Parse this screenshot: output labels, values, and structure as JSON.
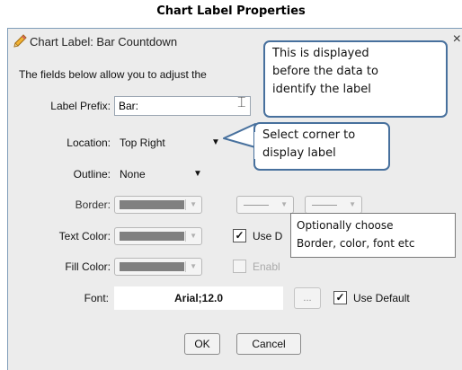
{
  "page_title": "Chart Label Properties",
  "dialog": {
    "title": "Chart Label: Bar Countdown",
    "close": "×",
    "description": "The fields below allow you to adjust the",
    "fields": {
      "label_prefix": {
        "label": "Label Prefix:",
        "value": "Bar:"
      },
      "location": {
        "label": "Location:",
        "value": "Top Right"
      },
      "outline": {
        "label": "Outline:",
        "value": "None"
      },
      "border": {
        "label": "Border:",
        "color": "#808080"
      },
      "text_color": {
        "label": "Text Color:",
        "color": "#808080",
        "use_default_label": "Use D",
        "use_default_checked": true
      },
      "fill_color": {
        "label": "Fill Color:",
        "color": "#808080",
        "enable_label": "Enabl",
        "enable_checked": false
      },
      "font": {
        "label": "Font:",
        "value": "Arial;12.0",
        "browse": "...",
        "use_default_label": "Use Default",
        "use_default_checked": true
      }
    },
    "buttons": {
      "ok": "OK",
      "cancel": "Cancel"
    }
  },
  "callouts": {
    "prefix": [
      "This is displayed",
      "before the data to",
      "identify the label"
    ],
    "corner": [
      "Select corner to",
      "display label"
    ],
    "optional": [
      "Optionally choose",
      "Border, color, font etc"
    ]
  },
  "colors": {
    "callout_border": "#47709d",
    "swatch": "#808080",
    "dialog_bg": "#ececec"
  },
  "icons": {
    "title_icon": "pencil-icon",
    "dropdown": "caret-down-icon"
  }
}
